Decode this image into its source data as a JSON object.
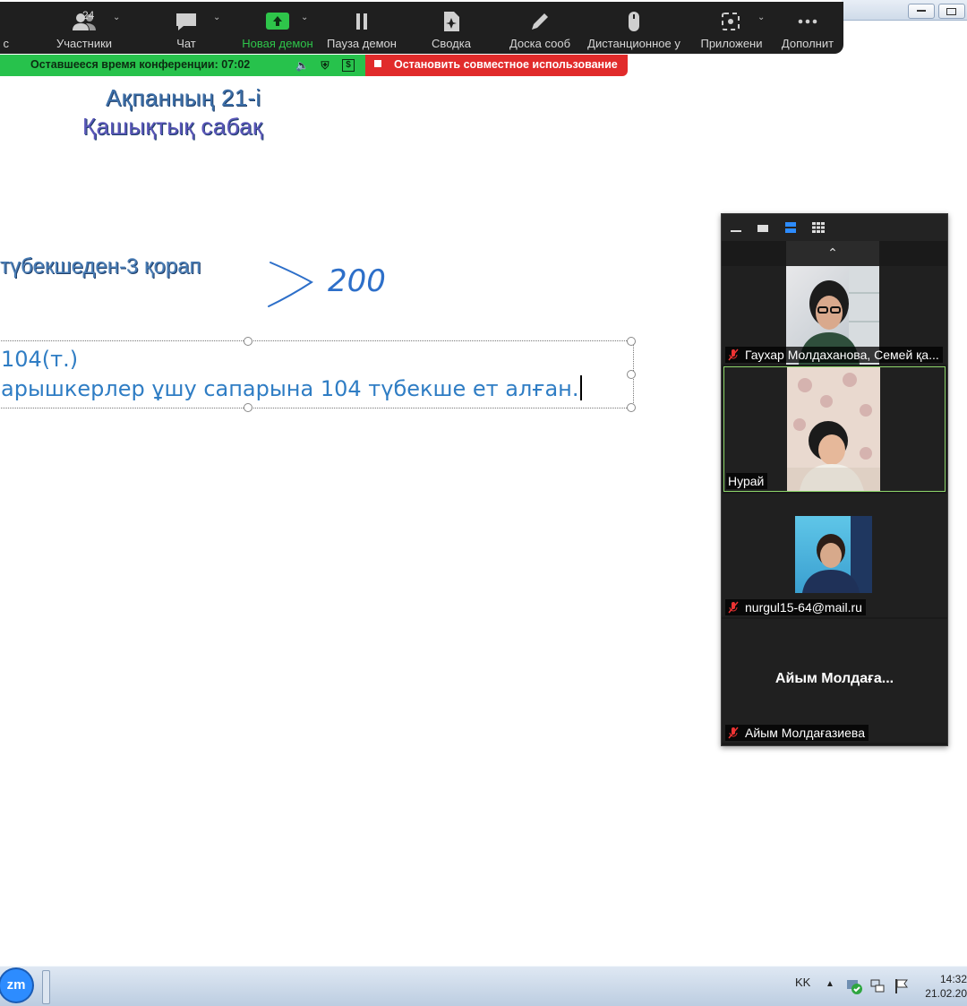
{
  "toolbar": {
    "items": [
      {
        "label": "с"
      },
      {
        "label": "Участники",
        "count": "24"
      },
      {
        "label": "Чат"
      },
      {
        "label": "Новая демон"
      },
      {
        "label": "Пауза демон"
      },
      {
        "label": "Сводка"
      },
      {
        "label": "Доска сооб"
      },
      {
        "label": "Дистанционное у"
      },
      {
        "label": "Приложени"
      },
      {
        "label": "Дополнит"
      }
    ]
  },
  "status": {
    "time_text": "Оставшееся время конференции: 07:02",
    "stop_text": "Остановить совместное использование"
  },
  "slide": {
    "title_line1": "Ақпанның 21-і",
    "title_line2": "Қашықтық сабақ",
    "line_a": "түбекшеден-3 қорап",
    "handwriting": "200",
    "text_line1": "104(т.)",
    "text_line2": "арышкерлер ұшу сапарына 104 түбекше ет алған."
  },
  "participants": [
    {
      "name": "Гаухар Молдаханова, Семей қа..."
    },
    {
      "name": "Нурай"
    },
    {
      "name": "nurgul15-64@mail.ru"
    },
    {
      "name": "Айым Молдағазиева",
      "display_name": "Айым  Молдаға..."
    }
  ],
  "taskbar": {
    "app": "zm",
    "lang": "KK",
    "time": "14:32",
    "date": "21.02.20"
  },
  "colors": {
    "toolbar_bg": "#1f1f1f",
    "time_bar": "#27c24c",
    "stop_bar": "#e12b2b",
    "active_speaker": "#8fd86b"
  }
}
